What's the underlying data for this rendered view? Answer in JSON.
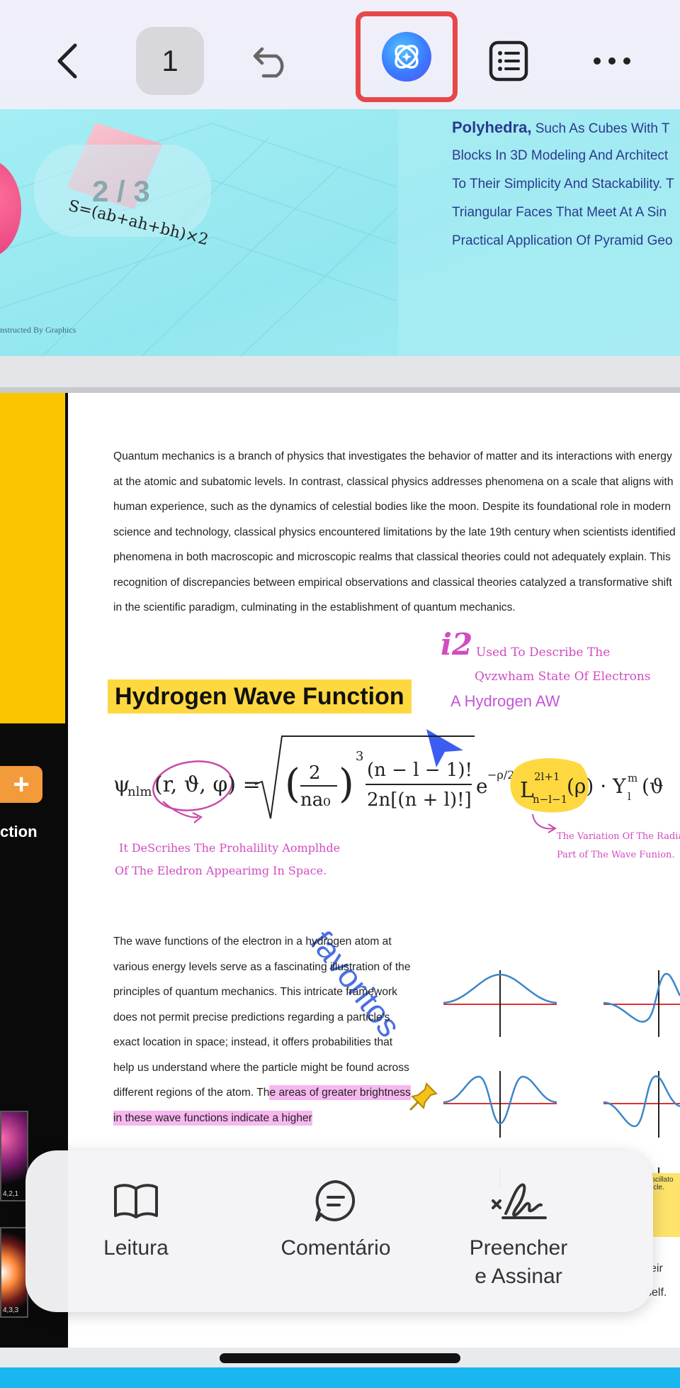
{
  "toolbar": {
    "page_number": "1"
  },
  "page_top": {
    "page_counter": "2 / 3",
    "formula": "S=(ab+ah+bh)×2",
    "constructed": "nstructed By Graphics",
    "lines": [
      {
        "bold": "Polyhedra,",
        "text": " Such As Cubes With T"
      },
      {
        "bold": "",
        "text": "Blocks In 3D Modeling And Architect"
      },
      {
        "bold": "",
        "text": "To Their Simplicity And Stackability. T"
      },
      {
        "bold": "",
        "text": "Triangular Faces That Meet At A Sin"
      },
      {
        "bold": "",
        "text": "Practical Application Of Pyramid Geo"
      }
    ]
  },
  "page_main": {
    "paragraph_top": "Quantum mechanics is a branch of physics that investigates the behavior of matter and its interactions with energy at the atomic and subatomic levels. In contrast, classical physics addresses phenomena on a scale that aligns with human experience, such as the dynamics of celestial bodies like the moon. Despite its foundational role in modern science and technology, classical physics encountered limitations by the late 19th century when scientists identified phenomena in both macroscopic and microscopic realms that classical theories could not adequately explain. This recognition of discrepancies between empirical observations and classical theories catalyzed a transformative shift in the scientific paradigm, culminating in the establishment of quantum mechanics.",
    "heading": "Hydrogen Wave Function",
    "annotation_i2": "i2",
    "annotation_used": "Used To Describe The",
    "annotation_qvz": "Qvzwham State Of Electrons",
    "annotation_ahyd": "A Hydrogen AW",
    "annotation_desc1": "It DeScrihes The Prohalility Aomplhde",
    "annotation_desc2": "Of The Eledron Appearimg In Space.",
    "annotation_radial1": "The Variation Of The Radia",
    "annotation_radial2": "Part of The Wave Funion.",
    "favoritos": "favoritos",
    "paragraph_left_plain": "The wave functions of the electron in a hydrogen atom at various energy levels serve as a fascinating illustration of the principles of quantum mechanics. This intricate framework does not permit precise predictions regarding a particle's exact location in space; instead, it offers probabilities that help us understand where the particle might be found across different regions of the atom. Th",
    "paragraph_left_highlight": "e areas of greater brightness in these wave functions indicate a higher",
    "side_action": "ction",
    "thumb_label_1": "4,2,1",
    "thumb_label_2": "4,3,3",
    "sticky_note": "scillato icle.",
    "fragment_eir": "eir",
    "fragment_self": "self."
  },
  "modes": {
    "read": "Leitura",
    "comment": "Comentário",
    "sign_line1": "Preencher",
    "sign_line2": "e Assinar"
  },
  "colors": {
    "accent_red": "#e8474a",
    "highlight_yellow": "#ffd840",
    "highlight_pink": "#f7b8f0",
    "annotation_magenta": "#d04cc0",
    "favoritos_blue": "#4b6fe0"
  }
}
